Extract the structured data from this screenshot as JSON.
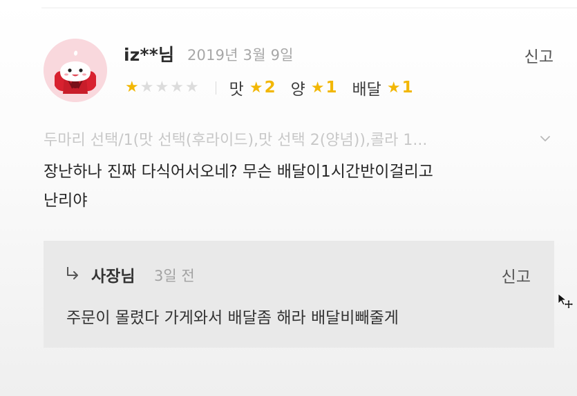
{
  "review": {
    "user_name": "iz**님",
    "date": "2019년 3월 9일",
    "report_label": "신고",
    "rating": 1,
    "max_rating": 5,
    "sub_ratings": [
      {
        "label": "맛",
        "score": "2"
      },
      {
        "label": "양",
        "score": "1"
      },
      {
        "label": "배달",
        "score": "1"
      }
    ],
    "order_menu": "두마리 선택/1(맛 선택(후라이드),맛 선택 2(양념)),콜라 1...",
    "body_line1": "장난하나 진짜 다식어서오네? 무슨 배달이1시간반이걸리고",
    "body_line2": "난리야"
  },
  "reply": {
    "author": "사장님",
    "date": "3일 전",
    "report_label": "신고",
    "text": "주문이 몰렸다 가게와서 배달좀 해라 배달비빼줄게"
  },
  "colors": {
    "star_active": "#f2b705",
    "star_inactive": "#dcdcdc",
    "avatar_bg": "#f9d8dd",
    "reply_bg": "#e9e9e9",
    "muted_text": "#c8c8c8"
  },
  "icons": {
    "avatar": "ghost-mascot-icon",
    "reply_arrow": "reply-arrow-icon",
    "expand": "chevron-down-icon",
    "cursor": "move-cursor-icon"
  }
}
